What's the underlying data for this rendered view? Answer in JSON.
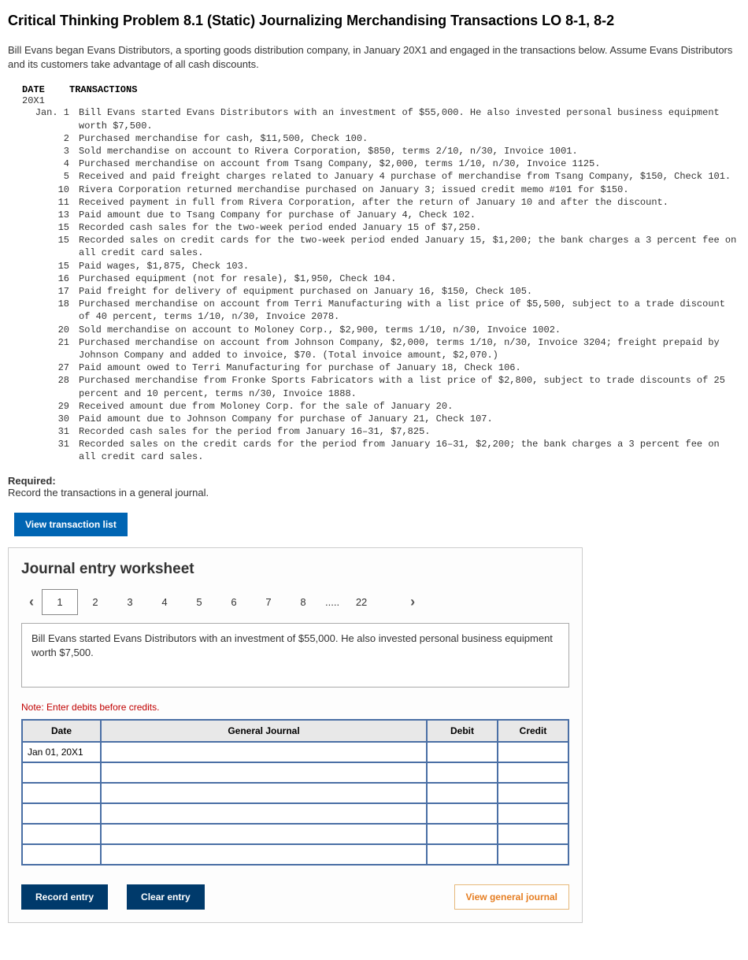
{
  "title": "Critical Thinking Problem 8.1 (Static) Journalizing Merchandising Transactions LO 8-1, 8-2",
  "intro": "Bill Evans began Evans Distributors, a sporting goods distribution company, in January 20X1 and engaged in the transactions below. Assume Evans Distributors and its customers take advantage of all cash discounts.",
  "table_head": {
    "c1": "DATE",
    "c2": "TRANSACTIONS"
  },
  "year": "20X1",
  "transactions": [
    {
      "d": "Jan. 1",
      "t": "Bill Evans started Evans Distributors with an investment of $55,000. He also invested personal business equipment worth $7,500."
    },
    {
      "d": "2",
      "t": "Purchased merchandise for cash, $11,500, Check 100."
    },
    {
      "d": "3",
      "t": "Sold merchandise on account to Rivera Corporation, $850, terms 2/10, n/30, Invoice 1001."
    },
    {
      "d": "4",
      "t": "Purchased merchandise on account from Tsang Company, $2,000, terms 1/10, n/30, Invoice 1125."
    },
    {
      "d": "5",
      "t": "Received and paid freight charges related to January 4 purchase of merchandise from Tsang Company, $150, Check 101."
    },
    {
      "d": "10",
      "t": "Rivera Corporation returned merchandise purchased on January 3; issued credit memo #101 for $150."
    },
    {
      "d": "11",
      "t": "Received payment in full from Rivera Corporation, after the return of January 10 and after the discount."
    },
    {
      "d": "13",
      "t": "Paid amount due to Tsang Company for purchase of January 4, Check 102."
    },
    {
      "d": "15",
      "t": "Recorded cash sales for the two-week period ended January 15 of $7,250."
    },
    {
      "d": "15",
      "t": "Recorded sales on credit cards for the two-week period ended January 15, $1,200; the bank charges a 3 percent fee on all credit card sales."
    },
    {
      "d": "15",
      "t": "Paid wages, $1,875, Check 103."
    },
    {
      "d": "16",
      "t": "Purchased equipment (not for resale), $1,950, Check 104."
    },
    {
      "d": "17",
      "t": "Paid freight for delivery of equipment purchased on January 16, $150, Check 105."
    },
    {
      "d": "18",
      "t": "Purchased merchandise on account from Terri Manufacturing with a list price of $5,500, subject to a trade discount of 40 percent, terms 1/10, n/30, Invoice 2078."
    },
    {
      "d": "20",
      "t": "Sold merchandise on account to Moloney Corp., $2,900, terms 1/10, n/30, Invoice 1002."
    },
    {
      "d": "21",
      "t": "Purchased merchandise on account from Johnson Company, $2,000, terms 1/10, n/30, Invoice 3204; freight prepaid by Johnson Company and added to invoice, $70. (Total invoice amount, $2,070.)"
    },
    {
      "d": "27",
      "t": "Paid amount owed to Terri Manufacturing for purchase of January 18, Check 106."
    },
    {
      "d": "28",
      "t": "Purchased merchandise from Fronke Sports Fabricators with a list price of $2,800, subject to trade discounts of 25 percent and 10 percent, terms n/30, Invoice 1888."
    },
    {
      "d": "29",
      "t": "Received amount due from Moloney Corp. for the sale of January 20."
    },
    {
      "d": "30",
      "t": "Paid amount due to Johnson Company for purchase of January 21, Check 107."
    },
    {
      "d": "31",
      "t": "Recorded cash sales for the period from January 16–31, $7,825."
    },
    {
      "d": "31",
      "t": "Recorded sales on the credit cards for the period from January 16–31, $2,200; the bank charges a 3 percent fee on all credit card sales."
    }
  ],
  "required": {
    "label": "Required:",
    "text": "Record the transactions in a general journal."
  },
  "view_tx_btn": "View transaction list",
  "worksheet": {
    "title": "Journal entry worksheet",
    "pages": [
      "1",
      "2",
      "3",
      "4",
      "5",
      "6",
      "7",
      "8"
    ],
    "ellipsis": ".....",
    "last_page": "22",
    "active_page": "1",
    "prompt": "Bill Evans started Evans Distributors with an investment of $55,000. He also invested personal business equipment worth $7,500.",
    "note": "Note: Enter debits before credits.",
    "cols": {
      "date": "Date",
      "acct": "General Journal",
      "debit": "Debit",
      "credit": "Credit"
    },
    "first_date": "Jan 01, 20X1",
    "row_count": 6,
    "record_btn": "Record entry",
    "clear_btn": "Clear entry",
    "view_gj_btn": "View general journal"
  }
}
